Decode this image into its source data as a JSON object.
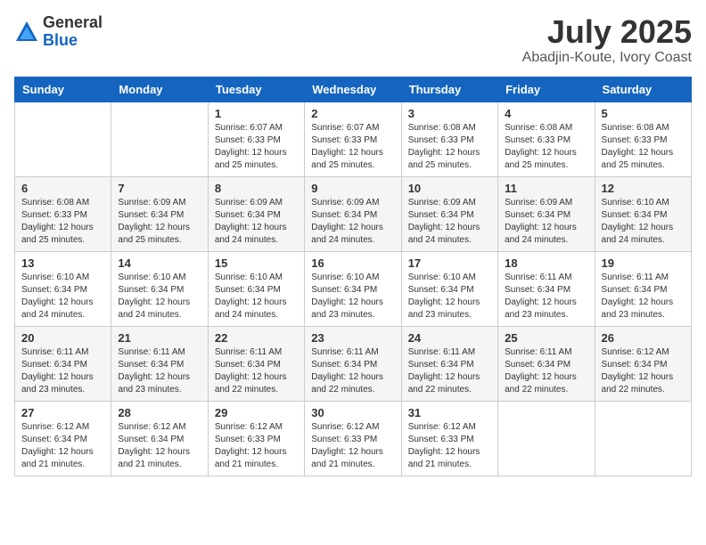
{
  "logo": {
    "general": "General",
    "blue": "Blue"
  },
  "title": {
    "month": "July 2025",
    "location": "Abadjin-Koute, Ivory Coast"
  },
  "headers": [
    "Sunday",
    "Monday",
    "Tuesday",
    "Wednesday",
    "Thursday",
    "Friday",
    "Saturday"
  ],
  "weeks": [
    [
      {
        "day": "",
        "info": ""
      },
      {
        "day": "",
        "info": ""
      },
      {
        "day": "1",
        "info": "Sunrise: 6:07 AM\nSunset: 6:33 PM\nDaylight: 12 hours and 25 minutes."
      },
      {
        "day": "2",
        "info": "Sunrise: 6:07 AM\nSunset: 6:33 PM\nDaylight: 12 hours and 25 minutes."
      },
      {
        "day": "3",
        "info": "Sunrise: 6:08 AM\nSunset: 6:33 PM\nDaylight: 12 hours and 25 minutes."
      },
      {
        "day": "4",
        "info": "Sunrise: 6:08 AM\nSunset: 6:33 PM\nDaylight: 12 hours and 25 minutes."
      },
      {
        "day": "5",
        "info": "Sunrise: 6:08 AM\nSunset: 6:33 PM\nDaylight: 12 hours and 25 minutes."
      }
    ],
    [
      {
        "day": "6",
        "info": "Sunrise: 6:08 AM\nSunset: 6:33 PM\nDaylight: 12 hours and 25 minutes."
      },
      {
        "day": "7",
        "info": "Sunrise: 6:09 AM\nSunset: 6:34 PM\nDaylight: 12 hours and 25 minutes."
      },
      {
        "day": "8",
        "info": "Sunrise: 6:09 AM\nSunset: 6:34 PM\nDaylight: 12 hours and 24 minutes."
      },
      {
        "day": "9",
        "info": "Sunrise: 6:09 AM\nSunset: 6:34 PM\nDaylight: 12 hours and 24 minutes."
      },
      {
        "day": "10",
        "info": "Sunrise: 6:09 AM\nSunset: 6:34 PM\nDaylight: 12 hours and 24 minutes."
      },
      {
        "day": "11",
        "info": "Sunrise: 6:09 AM\nSunset: 6:34 PM\nDaylight: 12 hours and 24 minutes."
      },
      {
        "day": "12",
        "info": "Sunrise: 6:10 AM\nSunset: 6:34 PM\nDaylight: 12 hours and 24 minutes."
      }
    ],
    [
      {
        "day": "13",
        "info": "Sunrise: 6:10 AM\nSunset: 6:34 PM\nDaylight: 12 hours and 24 minutes."
      },
      {
        "day": "14",
        "info": "Sunrise: 6:10 AM\nSunset: 6:34 PM\nDaylight: 12 hours and 24 minutes."
      },
      {
        "day": "15",
        "info": "Sunrise: 6:10 AM\nSunset: 6:34 PM\nDaylight: 12 hours and 24 minutes."
      },
      {
        "day": "16",
        "info": "Sunrise: 6:10 AM\nSunset: 6:34 PM\nDaylight: 12 hours and 23 minutes."
      },
      {
        "day": "17",
        "info": "Sunrise: 6:10 AM\nSunset: 6:34 PM\nDaylight: 12 hours and 23 minutes."
      },
      {
        "day": "18",
        "info": "Sunrise: 6:11 AM\nSunset: 6:34 PM\nDaylight: 12 hours and 23 minutes."
      },
      {
        "day": "19",
        "info": "Sunrise: 6:11 AM\nSunset: 6:34 PM\nDaylight: 12 hours and 23 minutes."
      }
    ],
    [
      {
        "day": "20",
        "info": "Sunrise: 6:11 AM\nSunset: 6:34 PM\nDaylight: 12 hours and 23 minutes."
      },
      {
        "day": "21",
        "info": "Sunrise: 6:11 AM\nSunset: 6:34 PM\nDaylight: 12 hours and 23 minutes."
      },
      {
        "day": "22",
        "info": "Sunrise: 6:11 AM\nSunset: 6:34 PM\nDaylight: 12 hours and 22 minutes."
      },
      {
        "day": "23",
        "info": "Sunrise: 6:11 AM\nSunset: 6:34 PM\nDaylight: 12 hours and 22 minutes."
      },
      {
        "day": "24",
        "info": "Sunrise: 6:11 AM\nSunset: 6:34 PM\nDaylight: 12 hours and 22 minutes."
      },
      {
        "day": "25",
        "info": "Sunrise: 6:11 AM\nSunset: 6:34 PM\nDaylight: 12 hours and 22 minutes."
      },
      {
        "day": "26",
        "info": "Sunrise: 6:12 AM\nSunset: 6:34 PM\nDaylight: 12 hours and 22 minutes."
      }
    ],
    [
      {
        "day": "27",
        "info": "Sunrise: 6:12 AM\nSunset: 6:34 PM\nDaylight: 12 hours and 21 minutes."
      },
      {
        "day": "28",
        "info": "Sunrise: 6:12 AM\nSunset: 6:34 PM\nDaylight: 12 hours and 21 minutes."
      },
      {
        "day": "29",
        "info": "Sunrise: 6:12 AM\nSunset: 6:33 PM\nDaylight: 12 hours and 21 minutes."
      },
      {
        "day": "30",
        "info": "Sunrise: 6:12 AM\nSunset: 6:33 PM\nDaylight: 12 hours and 21 minutes."
      },
      {
        "day": "31",
        "info": "Sunrise: 6:12 AM\nSunset: 6:33 PM\nDaylight: 12 hours and 21 minutes."
      },
      {
        "day": "",
        "info": ""
      },
      {
        "day": "",
        "info": ""
      }
    ]
  ]
}
